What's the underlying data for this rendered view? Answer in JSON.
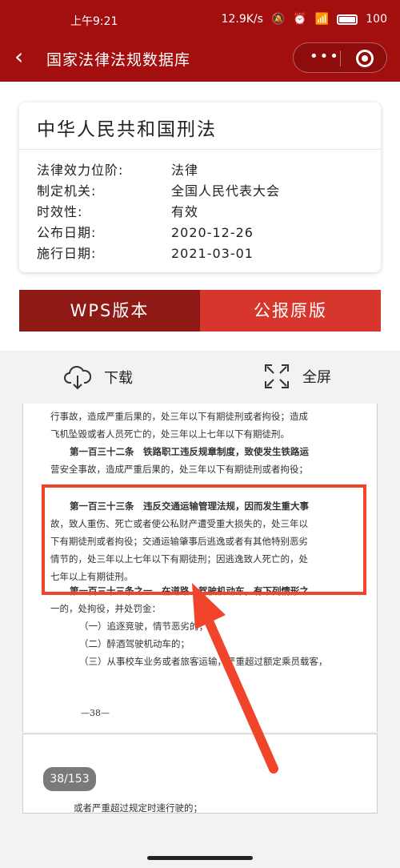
{
  "status": {
    "time": "上午9:21",
    "speed": "12.9K/s",
    "battery": "100"
  },
  "nav": {
    "back": "‹",
    "title": "国家法律法规数据库",
    "more": "•••"
  },
  "law": {
    "title": "中华人民共和国刑法",
    "fields": [
      {
        "key": "法律效力位阶:",
        "value": "法律"
      },
      {
        "key": "制定机关:",
        "value": "全国人民代表大会"
      },
      {
        "key": "时效性:",
        "value": "有效"
      },
      {
        "key": "公布日期:",
        "value": "2020-12-26"
      },
      {
        "key": "施行日期:",
        "value": "2021-03-01"
      }
    ]
  },
  "buttons": {
    "wps": "WPS版本",
    "gazette": "公报原版"
  },
  "tools": {
    "download": "下载",
    "fullscreen": "全屏"
  },
  "document": {
    "lines": [
      "行事故，造成严重后果的，处三年以下有期徒刑或者拘役；造成",
      "飞机坠毁或者人员死亡的，处三年以上七年以下有期徒刑。",
      "第一百三十二条　铁路职工违反规章制度，致使发生铁路运",
      "营安全事故，造成严重后果的，处三年以下有期徒刑或者拘役；",
      "第一百三十三条　违反交通运输管理法规，因而发生重大事",
      "故，致人重伤、死亡或者使公私财产遭受重大损失的，处三年以",
      "下有期徒刑或者拘役；交通运输肇事后逃逸或者有其他特别恶劣",
      "情节的，处三年以上七年以下有期徒刑；因逃逸致人死亡的，处",
      "七年以上有期徒刑。",
      "第一百三十三条之一　在道路上驾驶机动车，有下列情形之",
      "一的，处拘役，并处罚金：",
      "（一）追逐竞驶，情节恶劣的；",
      "（二）醉酒驾驶机动车的；",
      "（三）从事校车业务或者旅客运输，严重超过额定乘员载客，"
    ],
    "page_number": "—38—",
    "page_indicator": "38/153",
    "next_page_line": "或者严重超过规定时速行驶的；"
  },
  "colors": {
    "brand": "#a30e0e",
    "wps": "#8f1a15",
    "gazette": "#d6362b",
    "annotation": "#f0452a"
  }
}
